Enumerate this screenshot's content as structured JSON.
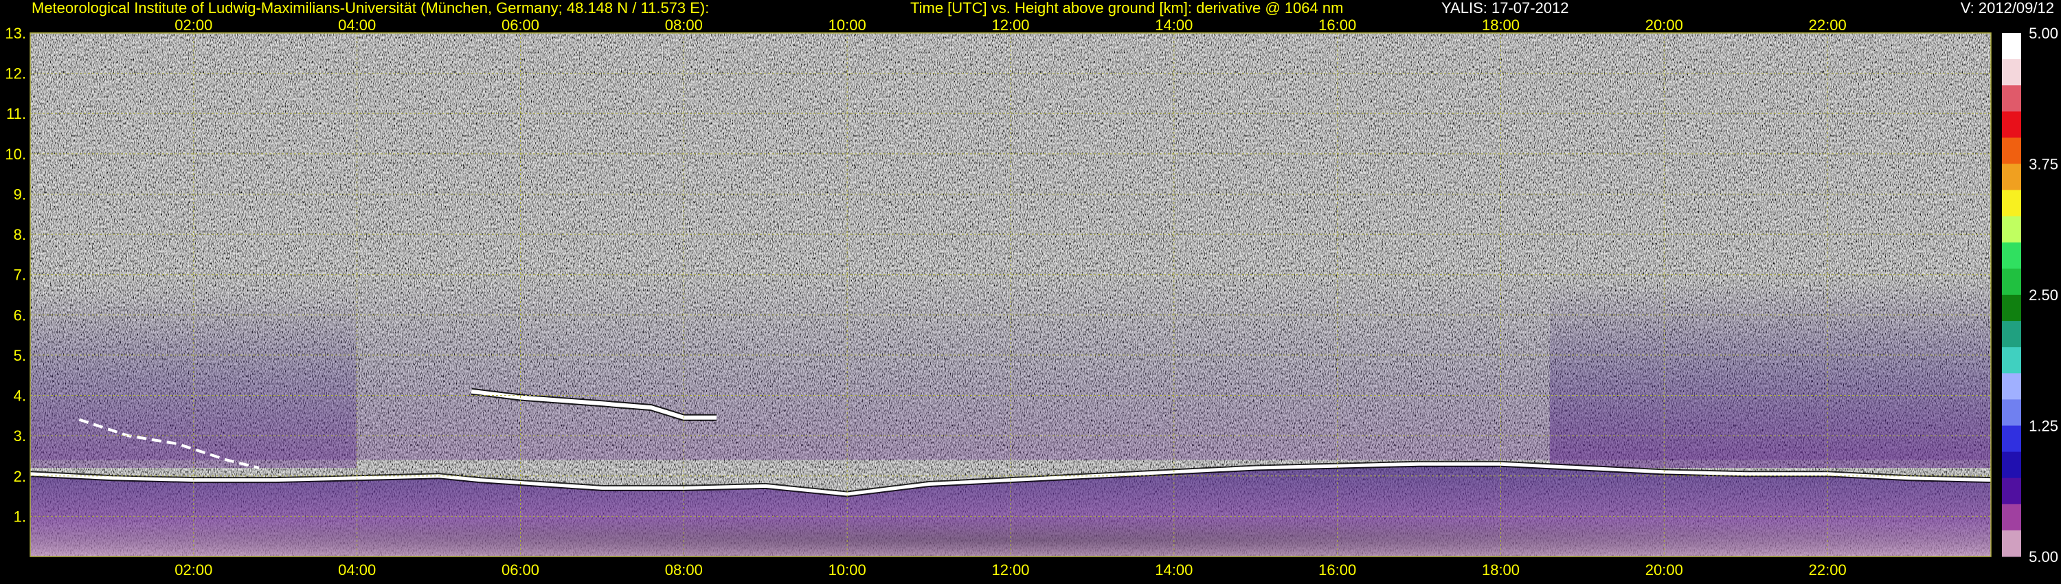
{
  "header": {
    "institute": "Meteorological Institute of Ludwig-Maximilians-Universität (München, Germany; 48.148 N / 11.573 E):",
    "plot_description": "Time [UTC] vs. Height above ground [km]: derivative @ 1064 nm",
    "instrument_date": "YALIS: 17-07-2012",
    "version": "V: 2012/09/12"
  },
  "colors": {
    "label_yellow": "#ffff00",
    "label_white": "#ffffff",
    "grid": "#b0b040",
    "background": "#000000"
  },
  "chart_data": {
    "type": "heatmap",
    "title": "Time [UTC] vs. Height above ground [km]: derivative @ 1064 nm",
    "xlabel": "Time [UTC]",
    "ylabel": "Height above ground [km]",
    "x_ticks": [
      "02:00",
      "04:00",
      "06:00",
      "08:00",
      "10:00",
      "12:00",
      "14:00",
      "16:00",
      "18:00",
      "20:00",
      "22:00"
    ],
    "x_tick_hours": [
      2,
      4,
      6,
      8,
      10,
      12,
      14,
      16,
      18,
      20,
      22
    ],
    "xlim_hours": [
      0,
      24
    ],
    "y_ticks": [
      "1.",
      "2.",
      "3.",
      "4.",
      "5.",
      "6.",
      "7.",
      "8.",
      "9.",
      "10.",
      "11.",
      "12.",
      "13."
    ],
    "y_tick_values": [
      1,
      2,
      3,
      4,
      5,
      6,
      7,
      8,
      9,
      10,
      11,
      12,
      13
    ],
    "ylim_km": [
      0,
      13
    ],
    "grid": true,
    "colorbar": {
      "labels": [
        "5.00",
        "3.75",
        "2.50",
        "1.25",
        "5.00"
      ],
      "label_values": [
        5.0,
        3.75,
        2.5,
        1.25,
        0.0
      ],
      "colors_top_to_bottom": [
        "#ffffff",
        "#f4d7dc",
        "#e05a6a",
        "#e8101a",
        "#f06010",
        "#f0a020",
        "#f8f020",
        "#c0ff60",
        "#30e060",
        "#20c040",
        "#108010",
        "#20a080",
        "#40d0c0",
        "#a0b0ff",
        "#7080f0",
        "#3030e0",
        "#2010b0",
        "#5010a0",
        "#a040a0",
        "#d0a0c0"
      ]
    },
    "features": {
      "boundary_layer_top_km": [
        {
          "hour": 0.0,
          "km": 2.05
        },
        {
          "hour": 1.0,
          "km": 1.95
        },
        {
          "hour": 2.0,
          "km": 1.9
        },
        {
          "hour": 3.0,
          "km": 1.9
        },
        {
          "hour": 4.0,
          "km": 1.95
        },
        {
          "hour": 5.0,
          "km": 2.0
        },
        {
          "hour": 5.5,
          "km": 1.9
        },
        {
          "hour": 7.0,
          "km": 1.7
        },
        {
          "hour": 8.0,
          "km": 1.7
        },
        {
          "hour": 9.0,
          "km": 1.75
        },
        {
          "hour": 10.0,
          "km": 1.55
        },
        {
          "hour": 11.0,
          "km": 1.8
        },
        {
          "hour": 12.0,
          "km": 1.9
        },
        {
          "hour": 13.0,
          "km": 2.0
        },
        {
          "hour": 14.0,
          "km": 2.1
        },
        {
          "hour": 15.0,
          "km": 2.2
        },
        {
          "hour": 16.0,
          "km": 2.25
        },
        {
          "hour": 17.0,
          "km": 2.3
        },
        {
          "hour": 18.0,
          "km": 2.3
        },
        {
          "hour": 19.0,
          "km": 2.2
        },
        {
          "hour": 20.0,
          "km": 2.1
        },
        {
          "hour": 21.0,
          "km": 2.05
        },
        {
          "hour": 22.0,
          "km": 2.05
        },
        {
          "hour": 23.0,
          "km": 1.95
        },
        {
          "hour": 24.0,
          "km": 1.9
        }
      ],
      "elevated_layer_km": [
        {
          "hour": 5.4,
          "km": 4.1
        },
        {
          "hour": 6.0,
          "km": 3.95
        },
        {
          "hour": 7.0,
          "km": 3.8
        },
        {
          "hour": 7.6,
          "km": 3.7
        },
        {
          "hour": 8.0,
          "km": 3.45
        },
        {
          "hour": 8.4,
          "km": 3.45
        }
      ],
      "morning_clouds_km": [
        {
          "hour": 0.6,
          "km": 3.4
        },
        {
          "hour": 1.2,
          "km": 3.0
        },
        {
          "hour": 1.8,
          "km": 2.8
        },
        {
          "hour": 2.4,
          "km": 2.4
        },
        {
          "hour": 2.8,
          "km": 2.2
        }
      ]
    }
  }
}
